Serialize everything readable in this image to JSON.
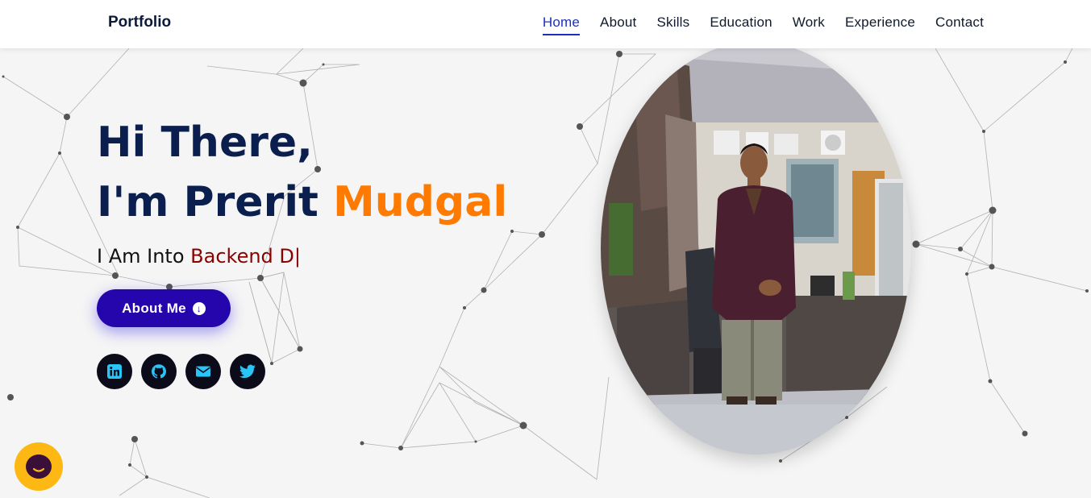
{
  "brand": "Portfolio",
  "nav": {
    "items": [
      {
        "label": "Home",
        "active": true
      },
      {
        "label": "About"
      },
      {
        "label": "Skills"
      },
      {
        "label": "Education"
      },
      {
        "label": "Work"
      },
      {
        "label": "Experience"
      },
      {
        "label": "Contact"
      }
    ]
  },
  "hero": {
    "greeting": "Hi There,",
    "name_prefix": "I'm Prerit ",
    "name_accent": "Mudgal",
    "typed_prefix": "I Am Into ",
    "typed_text": "Backend D",
    "cursor": "|",
    "about_button": "About Me",
    "about_icon": "arrow-down-circle-icon"
  },
  "socials": [
    {
      "name": "linkedin-icon"
    },
    {
      "name": "github-icon"
    },
    {
      "name": "email-icon"
    },
    {
      "name": "twitter-icon"
    }
  ],
  "colors": {
    "navy": "#0a1f4e",
    "accent_orange": "#ff7a00",
    "typed_red": "#8b0000",
    "button_blue": "#2506ad",
    "social_icon": "#29c5f6",
    "chat_yellow": "#fdb813"
  },
  "chat_widget": {
    "icon": "chat-bubble-icon"
  }
}
